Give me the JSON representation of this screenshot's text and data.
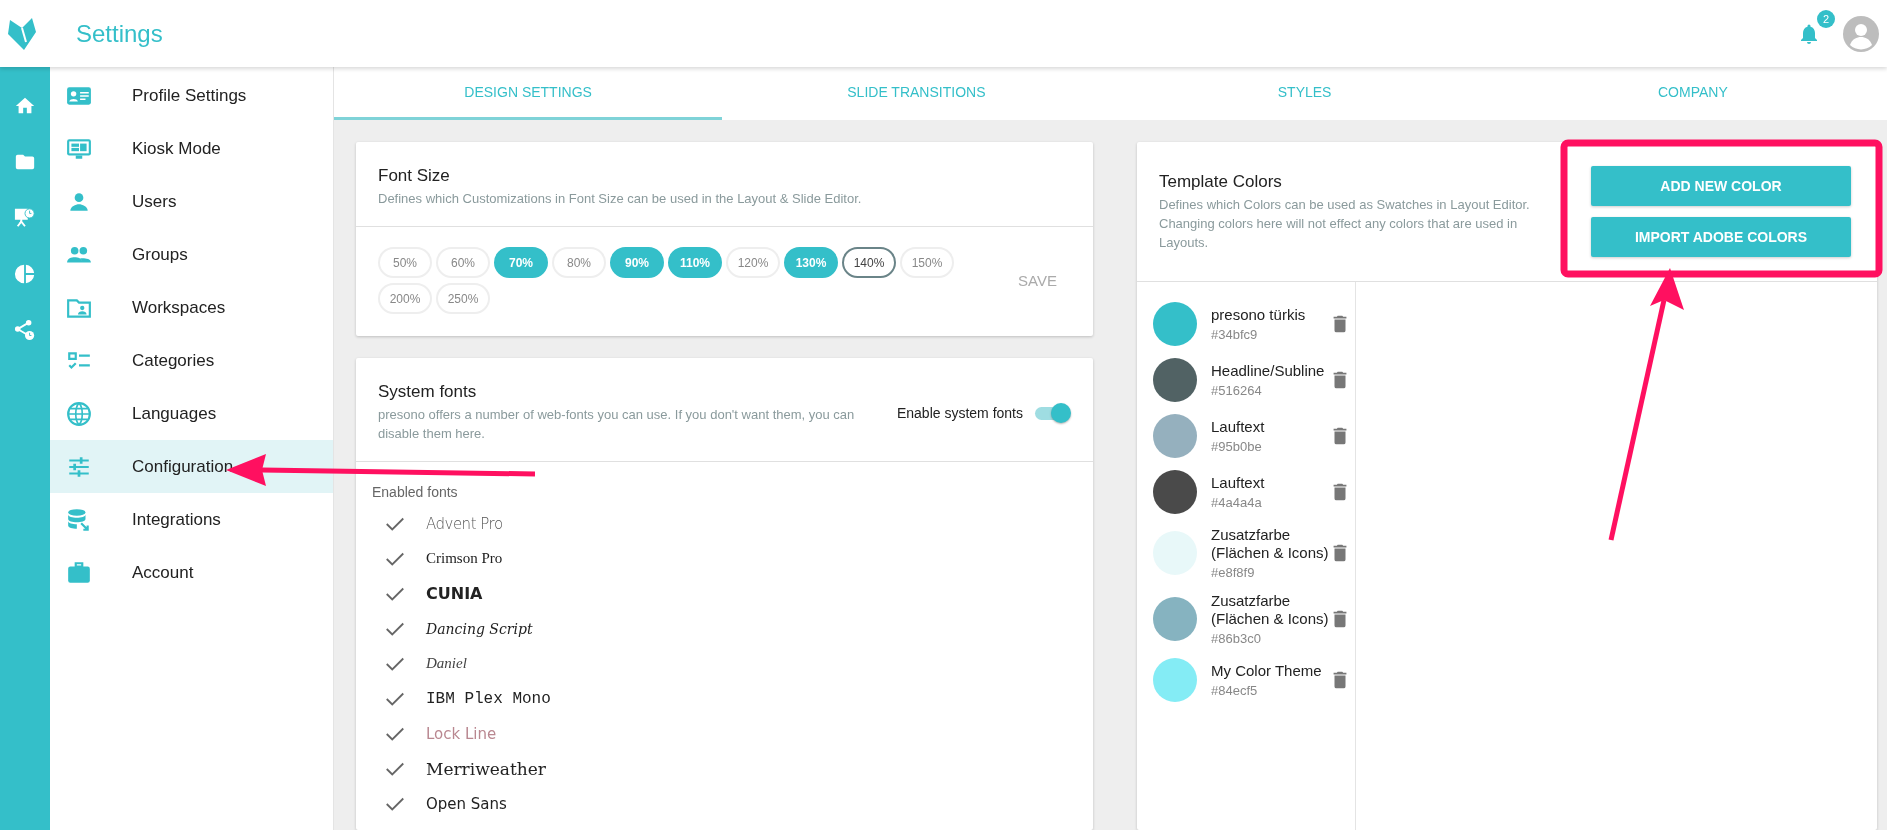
{
  "header": {
    "title": "Settings",
    "notifications": "2"
  },
  "rail": [
    {
      "kind": "home"
    },
    {
      "kind": "folder"
    },
    {
      "kind": "presentation"
    },
    {
      "kind": "pie"
    },
    {
      "kind": "share"
    }
  ],
  "sidebar": {
    "items": [
      {
        "label": "Profile Settings",
        "kind": "card",
        "selected": false
      },
      {
        "label": "Kiosk Mode",
        "kind": "monitor",
        "selected": false
      },
      {
        "label": "Users",
        "kind": "user",
        "selected": false
      },
      {
        "label": "Groups",
        "kind": "group",
        "selected": false
      },
      {
        "label": "Workspaces",
        "kind": "folder",
        "selected": false
      },
      {
        "label": "Categories",
        "kind": "checklist",
        "selected": false
      },
      {
        "label": "Languages",
        "kind": "globe",
        "selected": false
      },
      {
        "label": "Configuration",
        "kind": "sliders",
        "selected": true
      },
      {
        "label": "Integrations",
        "kind": "database",
        "selected": false
      },
      {
        "label": "Account",
        "kind": "briefcase",
        "selected": false
      }
    ]
  },
  "tabs": [
    {
      "label": "DESIGN SETTINGS",
      "selected": true
    },
    {
      "label": "SLIDE TRANSITIONS",
      "selected": false
    },
    {
      "label": "STYLES",
      "selected": false
    },
    {
      "label": "COMPANY",
      "selected": false
    }
  ],
  "font_size": {
    "title": "Font Size",
    "description": "Defines which Customizations in Font Size can be used in the Layout & Slide Editor.",
    "save": "SAVE",
    "options": [
      {
        "label": "50%",
        "selected": false,
        "focused": false
      },
      {
        "label": "60%",
        "selected": false,
        "focused": false
      },
      {
        "label": "70%",
        "selected": true,
        "focused": false
      },
      {
        "label": "80%",
        "selected": false,
        "focused": false
      },
      {
        "label": "90%",
        "selected": true,
        "focused": false
      },
      {
        "label": "110%",
        "selected": true,
        "focused": false
      },
      {
        "label": "120%",
        "selected": false,
        "focused": false
      },
      {
        "label": "130%",
        "selected": true,
        "focused": false
      },
      {
        "label": "140%",
        "selected": false,
        "focused": true
      },
      {
        "label": "150%",
        "selected": false,
        "focused": false
      },
      {
        "label": "200%",
        "selected": false,
        "focused": false
      },
      {
        "label": "250%",
        "selected": false,
        "focused": false
      }
    ]
  },
  "system_fonts": {
    "title": "System fonts",
    "description": "presono offers a number of web-fonts you can use. If you don't want them, you can disable them here.",
    "toggle_label": "Enable system fonts",
    "on": true,
    "list_label": "Enabled fonts",
    "fonts": [
      {
        "name": "Advent Pro",
        "kind": "light",
        "checked": true
      },
      {
        "name": "Crimson Pro",
        "kind": "serif",
        "checked": true
      },
      {
        "name": "CUNIA",
        "kind": "heavy",
        "checked": true
      },
      {
        "name": "Dancing Script",
        "kind": "script",
        "checked": true
      },
      {
        "name": "Daniel",
        "kind": "hand",
        "checked": true
      },
      {
        "name": "IBM Plex Mono",
        "kind": "mono",
        "checked": true
      },
      {
        "name": "Lock Line",
        "kind": "outline",
        "checked": true
      },
      {
        "name": "Merriweather",
        "kind": "bookserif",
        "checked": true
      },
      {
        "name": "Open Sans",
        "kind": "sans",
        "checked": true
      }
    ]
  },
  "template_colors": {
    "title": "Template Colors",
    "description": "Defines which Colors can be used as Swatches in Layout Editor. Changing colors here will not effect any colors that are used in Layouts.",
    "buttons": [
      "ADD NEW COLOR",
      "IMPORT ADOBE COLORS"
    ],
    "colors": [
      {
        "name": "presono türkis",
        "hex": "#34bfc9",
        "color": "#34bfc9"
      },
      {
        "name": "Headline/Subline",
        "hex": "#516264",
        "color": "#516264"
      },
      {
        "name": "Lauftext",
        "hex": "#95b0be",
        "color": "#95b0be"
      },
      {
        "name": "Lauftext",
        "hex": "#4a4a4a",
        "color": "#4a4a4a"
      },
      {
        "name": "Zusatzfarbe (Flächen & Icons)",
        "hex": "#e8f8f9",
        "color": "#e8f8f9"
      },
      {
        "name": "Zusatzfarbe (Flächen & Icons)",
        "hex": "#86b3c0",
        "color": "#86b3c0"
      },
      {
        "name": "My Color Theme",
        "hex": "#84ecf5",
        "color": "#84ecf5"
      }
    ]
  }
}
